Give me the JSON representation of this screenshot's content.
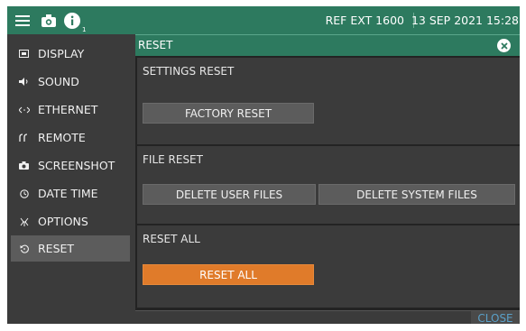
{
  "topbar": {
    "menu_icon": "hamburger-menu-icon",
    "camera_icon": "camera-icon",
    "info_icon": "info-icon",
    "info_badge": "1",
    "reference": "REF EXT 1600",
    "datetime": "13 SEP 2021 15:28",
    "accent": "#2d7a5f"
  },
  "sidebar": {
    "items": [
      {
        "label": "DISPLAY",
        "icon": "display-icon"
      },
      {
        "label": "SOUND",
        "icon": "speaker-icon"
      },
      {
        "label": "ETHERNET",
        "icon": "ethernet-icon"
      },
      {
        "label": "REMOTE",
        "icon": "remote-icon"
      },
      {
        "label": "SCREENSHOT",
        "icon": "camera-icon"
      },
      {
        "label": "DATE TIME",
        "icon": "clock-icon"
      },
      {
        "label": "OPTIONS",
        "icon": "options-icon"
      },
      {
        "label": "RESET",
        "icon": "reset-icon",
        "active": true
      }
    ]
  },
  "panel": {
    "title": "RESET",
    "close_icon": "close-circle-icon",
    "sections": {
      "settings": {
        "label": "SETTINGS RESET",
        "button": "FACTORY RESET"
      },
      "file": {
        "label": "FILE RESET",
        "button_user": "DELETE USER FILES",
        "button_system": "DELETE SYSTEM FILES"
      },
      "all": {
        "label": "RESET ALL",
        "button": "RESET ALL",
        "button_color": "#e07b2a"
      }
    },
    "footer_close": "CLOSE"
  }
}
